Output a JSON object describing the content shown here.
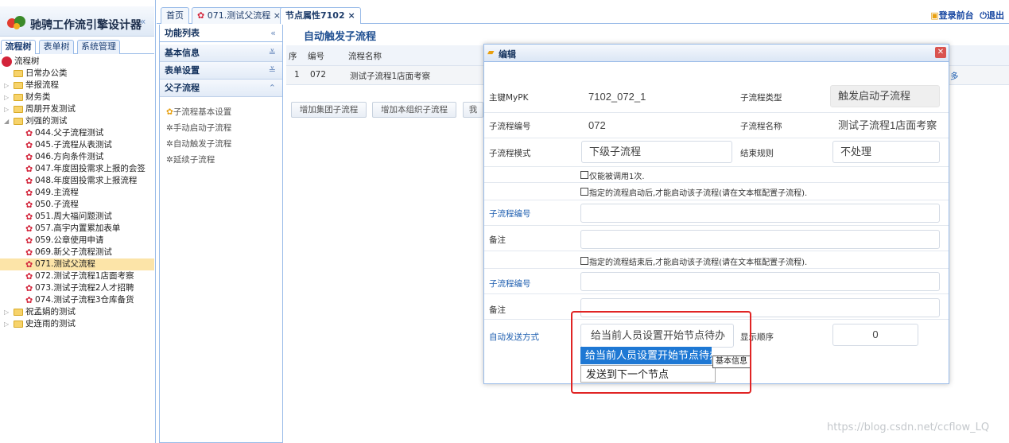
{
  "app": {
    "title": "驰骋工作流引擎设计器"
  },
  "left_tabs": [
    "流程树",
    "表单树",
    "系统管理"
  ],
  "tree": [
    {
      "label": "流程树",
      "level": 0,
      "kind": "root"
    },
    {
      "label": "日常办公类",
      "level": 1,
      "kind": "folder"
    },
    {
      "label": "举报流程",
      "level": 1,
      "kind": "folder",
      "expander": "▷"
    },
    {
      "label": "财务类",
      "level": 1,
      "kind": "folder",
      "expander": "▷"
    },
    {
      "label": "周朋开发测试",
      "level": 1,
      "kind": "folder",
      "expander": "▷"
    },
    {
      "label": "刘强的测试",
      "level": 1,
      "kind": "folder",
      "expander": "◢"
    },
    {
      "label": "044.父子流程测试",
      "level": 2,
      "kind": "flow"
    },
    {
      "label": "045.子流程从表测试",
      "level": 2,
      "kind": "flow"
    },
    {
      "label": "046.方向条件测试",
      "level": 2,
      "kind": "flow"
    },
    {
      "label": "047.年度固投需求上报的会签",
      "level": 2,
      "kind": "flow"
    },
    {
      "label": "048.年度固投需求上报流程",
      "level": 2,
      "kind": "flow"
    },
    {
      "label": "049.主流程",
      "level": 2,
      "kind": "flow"
    },
    {
      "label": "050.子流程",
      "level": 2,
      "kind": "flow"
    },
    {
      "label": "051.周大福问题测试",
      "level": 2,
      "kind": "flow"
    },
    {
      "label": "057.高宇内置累加表单",
      "level": 2,
      "kind": "flow"
    },
    {
      "label": "059.公章使用申请",
      "level": 2,
      "kind": "flow"
    },
    {
      "label": "069.新父子流程测试",
      "level": 2,
      "kind": "flow"
    },
    {
      "label": "071.测试父流程",
      "level": 2,
      "kind": "flow",
      "selected": true
    },
    {
      "label": "072.测试子流程1店面考察",
      "level": 2,
      "kind": "flow"
    },
    {
      "label": "073.测试子流程2人才招聘",
      "level": 2,
      "kind": "flow"
    },
    {
      "label": "074.测试子流程3仓库备货",
      "level": 2,
      "kind": "flow"
    },
    {
      "label": "祝孟娟的测试",
      "level": 1,
      "kind": "folder",
      "expander": "▷"
    },
    {
      "label": "史连雨的测试",
      "level": 1,
      "kind": "folder",
      "expander": "▷"
    }
  ],
  "tabs": {
    "home": "首页",
    "flow": "071.测试父流程",
    "node": "节点属性7102",
    "close": "×"
  },
  "toplinks": {
    "login": "登录前台",
    "logout": "退出"
  },
  "func": {
    "header": "功能列表",
    "sections": {
      "basic": "基本信息",
      "form": "表单设置",
      "parent": "父子流程"
    },
    "items": [
      "子流程基本设置",
      "手动启动子流程",
      "自动触发子流程",
      "延续子流程"
    ]
  },
  "main": {
    "title": "自动触发子流程",
    "grid_headers": {
      "seq": "序",
      "no": "编号",
      "name": "流程名称"
    },
    "row": {
      "seq": "1",
      "no": "072",
      "name": "测试子流程1店面考察"
    },
    "buttons": [
      "增加集团子流程",
      "增加本组织子流程",
      "我"
    ],
    "right_link": "多"
  },
  "dialog": {
    "title": "编辑",
    "pk_label": "主键MyPK",
    "pk_value": "7102_072_1",
    "type_label": "子流程类型",
    "type_value": "触发启动子流程",
    "no_label": "子流程编号",
    "no_value": "072",
    "name_label": "子流程名称",
    "name_value": "测试子流程1店面考察",
    "mode_label": "子流程模式",
    "mode_value": "下级子流程",
    "end_label": "结束规则",
    "end_value": "不处理",
    "cb1": "仅能被调用1次.",
    "cb2": "指定的流程启动后,才能启动该子流程(请在文本框配置子流程).",
    "sub_no_label": "子流程编号",
    "note_label": "备注",
    "cb3": "指定的流程结束后,才能启动该子流程(请在文本框配置子流程).",
    "send_label": "自动发送方式",
    "send_value": "给当前人员设置开始节点待办",
    "order_label": "显示顺序",
    "order_value": "0",
    "options": [
      "给当前人员设置开始节点待办",
      "发送到下一个节点"
    ],
    "tooltip": "基本信息"
  },
  "watermark": "https://blog.csdn.net/ccflow_LQ",
  "colors": {
    "accent": "#1e78d4",
    "highlight_box": "#e02424",
    "selected_row": "#fce4a8"
  }
}
